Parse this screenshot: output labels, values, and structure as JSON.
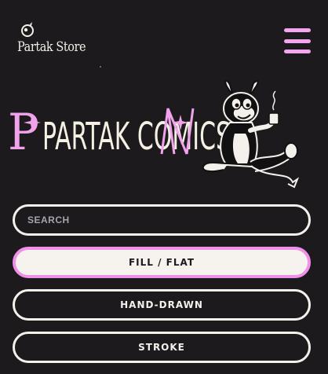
{
  "header": {
    "logo_text": "Partak Store",
    "menu_icon": "hamburger-menu-icon"
  },
  "hero": {
    "title": "PARTAK COMICS",
    "mascot": "devil-cat-mascot-illustration"
  },
  "search": {
    "placeholder": "SEARCH"
  },
  "filters": [
    {
      "label": "FILL / FLAT",
      "selected": true
    },
    {
      "label": "HAND-DRAWN",
      "selected": false
    },
    {
      "label": "STROKE",
      "selected": false
    }
  ],
  "colors": {
    "background": "#1c1a1d",
    "accent_pink": "#f190e8",
    "cream": "#f6f3ee"
  }
}
